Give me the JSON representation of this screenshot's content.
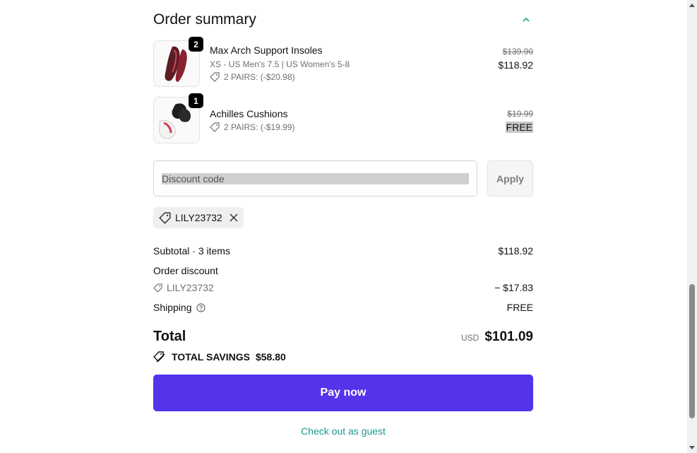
{
  "order_summary": {
    "title": "Order summary",
    "items": [
      {
        "name": "Max Arch Support Insoles",
        "variant": "XS - US Men's 7.5 | US Women's 5-8",
        "promo": "2 PAIRS: (-$20.98)",
        "quantity": "2",
        "original_price": "$139.90",
        "price": "$118.92"
      },
      {
        "name": "Achilles Cushions",
        "promo": "2 PAIRS: (-$19.99)",
        "quantity": "1",
        "original_price": "$19.99",
        "price": "FREE"
      }
    ]
  },
  "discount": {
    "placeholder": "Discount code",
    "apply_label": "Apply",
    "applied_code": "LILY23732"
  },
  "totals": {
    "subtotal_label": "Subtotal · 3 items",
    "subtotal_value": "$118.92",
    "order_discount_label": "Order discount",
    "order_discount_code": "LILY23732",
    "order_discount_value": "− $17.83",
    "shipping_label": "Shipping",
    "shipping_value": "FREE",
    "total_label": "Total",
    "currency": "USD",
    "total_value": "$101.09",
    "savings_label": "TOTAL SAVINGS",
    "savings_value": "$58.80"
  },
  "actions": {
    "pay_label": "Pay now",
    "guest_label": "Check out as guest"
  },
  "colors": {
    "primary": "#5433eb",
    "link": "#1a9a8e",
    "muted_text": "#707070"
  },
  "icons": [
    "chevron-up-icon",
    "tag-icon",
    "close-icon",
    "help-icon",
    "savings-tag-icon"
  ]
}
